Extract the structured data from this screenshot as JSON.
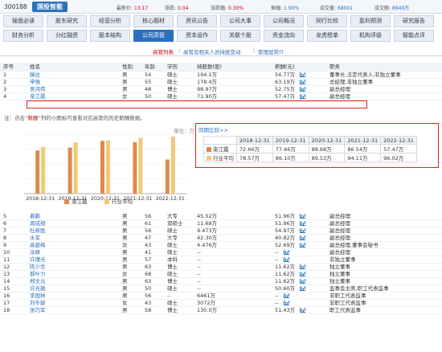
{
  "header": {
    "code": "300188",
    "name": "国投智能",
    "stats": [
      {
        "label": "最新价:",
        "value": "13.17"
      },
      {
        "label": "涨跌:",
        "value": "0.04"
      },
      {
        "label": "涨跌幅:",
        "value": "0.30%"
      },
      {
        "label": "振幅:",
        "value": "1.90%"
      },
      {
        "label": "成交量:",
        "value": "68001"
      },
      {
        "label": "成交额:",
        "value": "8949万"
      }
    ]
  },
  "nav_row1": [
    "操盘必读",
    "股东研究",
    "经营分析",
    "核心题材",
    "资讯公告",
    "公司大事",
    "公司概况",
    "同行比较",
    "盈利预测",
    "研究报告"
  ],
  "nav_row2": [
    "财务分析",
    "分红融资",
    "股本结构",
    "公司高管",
    "资本运作",
    "关联个股",
    "资金流向",
    "龙虎榜单",
    "机构评级",
    "智能点评"
  ],
  "active_nav": "公司高管",
  "subtabs": {
    "selected": "高管列表",
    "links": [
      "高管及相关人员持股变动",
      "管理层简介"
    ]
  },
  "table_headers": [
    "序号",
    "姓名",
    "性别",
    "年龄",
    "学历",
    "持股数(股)",
    "薪酬(元)",
    "职务"
  ],
  "rows_top": [
    {
      "no": "1",
      "name": "滕达",
      "sex": "男",
      "age": "54",
      "edu": "硕士",
      "shares": "194.1万",
      "pay": "54.77万",
      "job": "董事长,法定代表人,非独立董事"
    },
    {
      "no": "2",
      "name": "申强",
      "sex": "男",
      "age": "55",
      "edu": "硕士",
      "shares": "178.4万",
      "pay": "63.19万",
      "job": "总经理,非独立董事"
    },
    {
      "no": "3",
      "name": "吴鸿伟",
      "sex": "男",
      "age": "48",
      "edu": "博士",
      "shares": "98.97万",
      "pay": "52.75万",
      "job": "副总经理"
    },
    {
      "no": "4",
      "name": "栾江霞",
      "sex": "女",
      "age": "50",
      "edu": "硕士",
      "shares": "71.90万",
      "pay": "57.47万",
      "job": "副总经理"
    }
  ],
  "note": {
    "prefix": "注：点击“",
    "highlight": "薪酬",
    "suffix": "”列的小图标可查看对应高管的历史薪酬数据。"
  },
  "chart_unit": "单位：万元",
  "compare": {
    "title": "同期比较>>",
    "years": [
      "2018-12-31",
      "2019-12-31",
      "2020-12-31",
      "2021-12-31",
      "2022-12-31"
    ],
    "rows": [
      {
        "label": "栾江霞",
        "values": [
          "72.66万",
          "77.66万",
          "88.68万",
          "86.54万",
          "57.47万"
        ]
      },
      {
        "label": "行业平均",
        "values": [
          "78.57万",
          "86.10万",
          "89.53万",
          "94.11万",
          "96.02万"
        ]
      }
    ]
  },
  "chart_data": {
    "type": "bar",
    "categories": [
      "2018-12-31",
      "2019-12-31",
      "2020-12-31",
      "2021-12-31",
      "2022-12-31"
    ],
    "series": [
      {
        "name": "栾江霞",
        "values": [
          72.66,
          77.66,
          88.68,
          86.54,
          57.47
        ],
        "color": "#e08a4a"
      },
      {
        "name": "行业平均",
        "values": [
          78.57,
          86.1,
          89.53,
          94.11,
          96.02
        ],
        "color": "#f3c77a"
      }
    ],
    "ylim": [
      0,
      100
    ],
    "legend": "bottom"
  },
  "rows_bottom": [
    {
      "no": "5",
      "name": "慕鹏",
      "sex": "男",
      "age": "56",
      "edu": "大专",
      "shares": "45.02万",
      "pay": "51.96万",
      "job": "副总经理"
    },
    {
      "no": "6",
      "name": "周成祖",
      "sex": "男",
      "age": "61",
      "edu": "双硕士",
      "shares": "11.68万",
      "pay": "51.96万",
      "job": "副总经理"
    },
    {
      "no": "7",
      "name": "杜新胜",
      "sex": "男",
      "age": "56",
      "edu": "硕士",
      "shares": "9.473万",
      "pay": "54.97万",
      "job": "副总经理"
    },
    {
      "no": "8",
      "name": "水军",
      "sex": "男",
      "age": "47",
      "edu": "大专",
      "shares": "42.30万",
      "pay": "40.82万",
      "job": "副总经理"
    },
    {
      "no": "9",
      "name": "高碧梅",
      "sex": "女",
      "age": "43",
      "edu": "硕士",
      "shares": "4.476万",
      "pay": "52.69万",
      "job": "副总经理,董事会秘书"
    },
    {
      "no": "10",
      "name": "涂峥",
      "sex": "男",
      "age": "41",
      "edu": "硕士",
      "shares": "--",
      "pay": "--",
      "job": "副总经理"
    },
    {
      "no": "11",
      "name": "许瑾光",
      "sex": "男",
      "age": "57",
      "edu": "本科",
      "shares": "--",
      "pay": "--",
      "job": "非独立董事"
    },
    {
      "no": "12",
      "name": "陈少华",
      "sex": "男",
      "age": "63",
      "edu": "博士",
      "shares": "--",
      "pay": "11.62万",
      "job": "独立董事"
    },
    {
      "no": "13",
      "name": "郝叶力",
      "sex": "女",
      "age": "68",
      "edu": "硕士",
      "shares": "--",
      "pay": "11.62万",
      "job": "独立董事"
    },
    {
      "no": "14",
      "name": "郑文元",
      "sex": "男",
      "age": "63",
      "edu": "博士",
      "shares": "--",
      "pay": "11.62万",
      "job": "独立董事"
    },
    {
      "no": "15",
      "name": "许光雄",
      "sex": "男",
      "age": "50",
      "edu": "硕士",
      "shares": "--",
      "pay": "50.60万",
      "job": "监事会主席,职工代表监事"
    },
    {
      "no": "16",
      "name": "李国林",
      "sex": "男",
      "age": "56",
      "edu": "--",
      "shares": "6461万",
      "pay": "--",
      "job": "非职工代表监事"
    },
    {
      "no": "17",
      "name": "刘冬颖",
      "sex": "女",
      "age": "43",
      "edu": "硕士",
      "shares": "3072万",
      "pay": "--",
      "job": "非职工代表监事"
    },
    {
      "no": "18",
      "name": "张巧军",
      "sex": "男",
      "age": "58",
      "edu": "博士",
      "shares": "130.0万",
      "pay": "51.43万",
      "job": "职工代表监事"
    }
  ]
}
